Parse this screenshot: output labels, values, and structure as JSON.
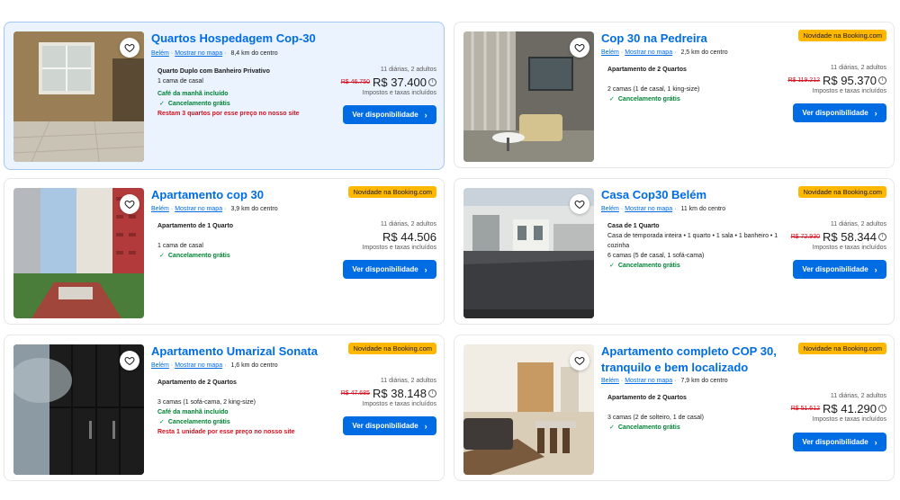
{
  "common": {
    "city": "Belém",
    "map_link": "Mostrar no mapa",
    "button_label": "Ver disponibilidade",
    "taxes_note": "Impostos e taxas incluídos",
    "badge_text": "Novidade na Booking.com",
    "heart_icon": "heart-icon",
    "chevron_icon": "chevron-right-icon"
  },
  "listings": [
    {
      "title": "Quartos Hospedagem Cop-30",
      "distance": "8,4 km do centro",
      "room_type": "Quarto Duplo com Banheiro Privativo",
      "description": "",
      "beds": "1 cama de casal",
      "breakfast": "Café da manhã incluído",
      "cancellation": "Cancelamento grátis",
      "scarcity": "Restam 3 quartos por esse preço no nosso site",
      "nights_guests": "11 diárias, 2 adultos",
      "old_price": "R$ 46.750",
      "price": "R$ 37.400"
    },
    {
      "title": "Cop 30 na Pedreira",
      "distance": "2,5 km do centro",
      "room_type": "Apartamento de 2 Quartos",
      "description": "",
      "beds": "2 camas (1 de casal, 1 king-size)",
      "breakfast": "",
      "cancellation": "Cancelamento grátis",
      "scarcity": "",
      "nights_guests": "11 diárias, 2 adultos",
      "old_price": "R$ 119.212",
      "price": "R$ 95.370"
    },
    {
      "title": "Apartamento cop 30",
      "distance": "3,9 km do centro",
      "room_type": "Apartamento de 1 Quarto",
      "description": "",
      "beds": "1 cama de casal",
      "breakfast": "",
      "cancellation": "Cancelamento grátis",
      "scarcity": "",
      "nights_guests": "11 diárias, 2 adultos",
      "old_price": "",
      "price": "R$ 44.506"
    },
    {
      "title": "Casa Cop30 Belém",
      "distance": "11 km do centro",
      "room_type": "Casa de 1 Quarto",
      "description": "Casa de temporada inteira • 1 quarto • 1 sala • 1 banheiro • 1 cozinha",
      "beds": "6 camas (5 de casal, 1 sofá-cama)",
      "breakfast": "",
      "cancellation": "Cancelamento grátis",
      "scarcity": "",
      "nights_guests": "11 diárias, 2 adultos",
      "old_price": "R$ 72.930",
      "price": "R$ 58.344"
    },
    {
      "title": "Apartamento Umarizal Sonata",
      "distance": "1,6 km do centro",
      "room_type": "Apartamento de 2 Quartos",
      "description": "",
      "beds": "3 camas (1 sofá-cama, 2 king-size)",
      "breakfast": "Café da manhã incluído",
      "cancellation": "Cancelamento grátis",
      "scarcity": "Resta 1 unidade por esse preço no nosso site",
      "nights_guests": "11 diárias, 2 adultos",
      "old_price": "R$ 47.685",
      "price": "R$ 38.148"
    },
    {
      "title_line1": "Apartamento completo COP 30,",
      "title_line2": "tranquilo e bem localizado",
      "distance": "7,9 km do centro",
      "room_type": "Apartamento de 2 Quartos",
      "description": "",
      "beds": "3 camas (2 de solteiro, 1 de casal)",
      "breakfast": "",
      "cancellation": "Cancelamento grátis",
      "scarcity": "",
      "nights_guests": "11 diárias, 2 adultos",
      "old_price": "R$ 51.612",
      "price": "R$ 41.290"
    }
  ]
}
